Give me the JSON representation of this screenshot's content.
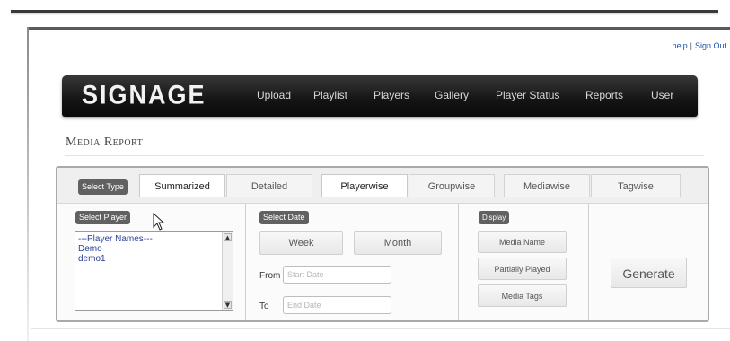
{
  "top_links": {
    "help": "help",
    "separator": "|",
    "sign_out": "Sign Out"
  },
  "header": {
    "logo": "SIGNAGE",
    "nav": [
      "Upload",
      "Playlist",
      "Players",
      "Gallery",
      "Player Status",
      "Reports",
      "User"
    ]
  },
  "page": {
    "title": "Media Report"
  },
  "type_row": {
    "label": "Select Type",
    "tabs": [
      "Summarized",
      "Detailed",
      "Playerwise",
      "Groupwise",
      "Mediawise",
      "Tagwise"
    ],
    "active_tabs": [
      "Summarized",
      "Playerwise"
    ]
  },
  "player": {
    "label": "Select Player",
    "options": [
      "---Player Names---",
      "Demo",
      "demo1"
    ]
  },
  "date": {
    "label": "Select Date",
    "week": "Week",
    "month": "Month",
    "from_label": "From",
    "from_placeholder": "Start Date",
    "to_label": "To",
    "to_placeholder": "End Date"
  },
  "display": {
    "label": "Display",
    "options": [
      "Media Name",
      "Partially Played",
      "Media Tags"
    ]
  },
  "actions": {
    "generate": "Generate"
  },
  "colors": {
    "nav_bg": "#141414",
    "label_pill": "#616161",
    "link": "#1d4fae",
    "list_text": "#2a3f9a"
  }
}
